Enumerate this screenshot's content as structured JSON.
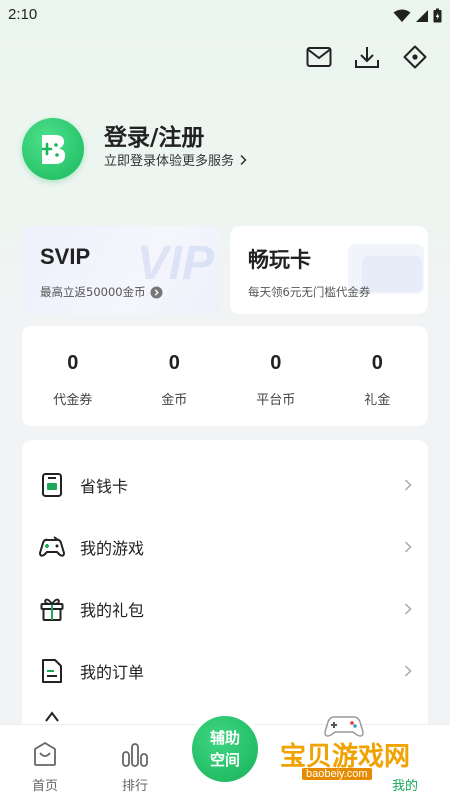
{
  "status_bar": {
    "time": "2:10"
  },
  "top_icons": [
    "mail-icon",
    "download-icon",
    "diamond-nav-icon"
  ],
  "profile": {
    "title": "登录/注册",
    "subtitle": "立即登录体验更多服务"
  },
  "cards": {
    "svip": {
      "title": "SVIP",
      "subtitle": "最高立返50000金币",
      "watermark": "VIP"
    },
    "play": {
      "title": "畅玩卡",
      "subtitle": "每天领6元无门槛代金券"
    }
  },
  "assets": [
    {
      "value": "0",
      "label": "代金券"
    },
    {
      "value": "0",
      "label": "金币"
    },
    {
      "value": "0",
      "label": "平台币"
    },
    {
      "value": "0",
      "label": "礼金"
    }
  ],
  "menu": [
    {
      "label": "省钱卡",
      "icon": "savings-card-icon"
    },
    {
      "label": "我的游戏",
      "icon": "gamepad-icon"
    },
    {
      "label": "我的礼包",
      "icon": "gift-icon"
    },
    {
      "label": "我的订单",
      "icon": "order-icon"
    }
  ],
  "tabbar": {
    "home": "首页",
    "rank": "排行",
    "fab_line1": "辅助",
    "fab_line2": "空间",
    "me": "我的"
  },
  "watermark": {
    "text": "宝贝游戏网",
    "url": "baobeiy.com"
  },
  "colors": {
    "accent": "#1aa957",
    "fab": "#17b358",
    "watermark": "#f0a200"
  }
}
